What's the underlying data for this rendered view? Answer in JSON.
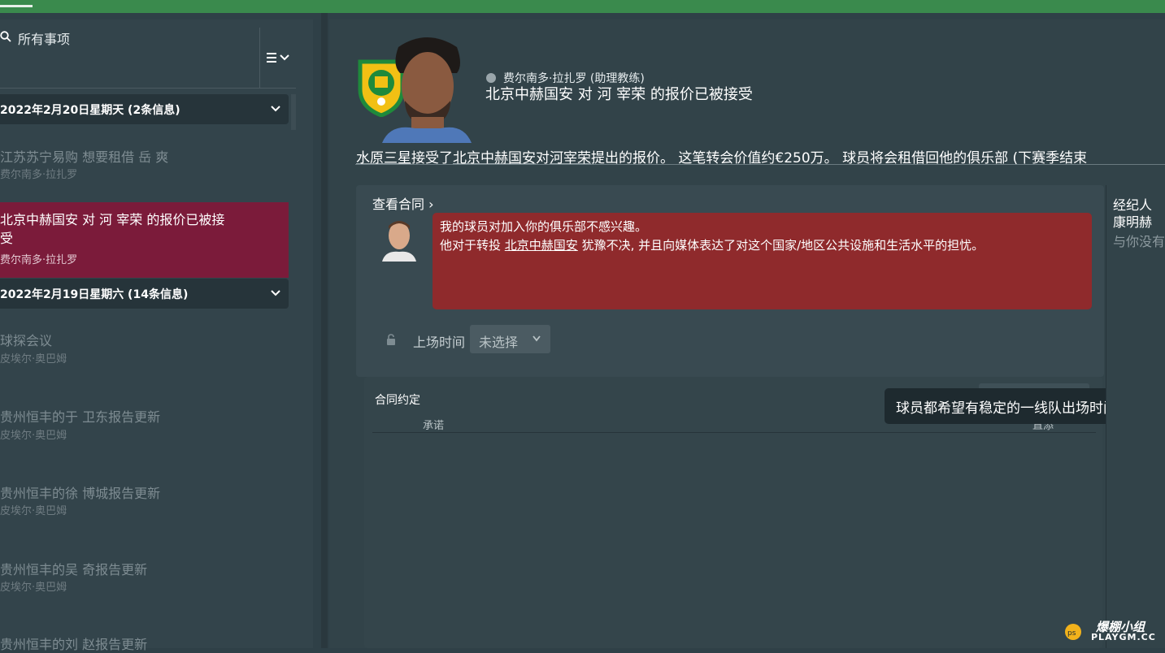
{
  "inbox": {
    "filter_label": "所有事项",
    "groups": [
      {
        "date": "2022年2月20日星期天 (2条信息)",
        "messages": [
          {
            "title": "江苏苏宁易购 想要租借 岳 爽",
            "sender": "费尔南多·拉扎罗"
          },
          {
            "title": "北京中赫国安 对 河 宰荣 的报价已被接受",
            "sender": "费尔南多·拉扎罗",
            "selected": true
          }
        ]
      },
      {
        "date": "2022年2月19日星期六 (14条信息)",
        "messages": [
          {
            "title": "球探会议",
            "sender": "皮埃尔·奥巴姆"
          },
          {
            "title": "贵州恒丰的于 卫东报告更新",
            "sender": "皮埃尔·奥巴姆"
          },
          {
            "title": "贵州恒丰的徐 博城报告更新",
            "sender": "皮埃尔·奥巴姆"
          },
          {
            "title": "贵州恒丰的吴 奇报告更新",
            "sender": "皮埃尔·奥巴姆"
          },
          {
            "title": "贵州恒丰的刘 赵报告更新",
            "sender": ""
          }
        ]
      }
    ]
  },
  "message": {
    "sender": "费尔南多·拉扎罗 (助理教练)",
    "subject": "北京中赫国安 对 河 宰荣 的报价已被接受",
    "body": {
      "p1": "水原三星",
      "p2": "接受了",
      "p3": "北京中赫国安",
      "p4": "对",
      "p5": "河宰荣",
      "p6": "提出的报价。 这笔转会价值约€250万。 球员将会租借回他的俱乐部 (下赛季结束"
    },
    "view_contract": "查看合同",
    "agent_reply": {
      "line1": "我的球员对加入你的俱乐部不感兴趣。",
      "line2_a": "他对于转投 ",
      "line2_club": "北京中赫国安",
      "line2_b": " 犹豫不决, 并且向媒体表达了对这个国家/地区公共设施和生活水平的担忧。"
    },
    "playing_time_label": "上场时间",
    "playing_time_value": "未选择",
    "contract_terms_title": "合同约定",
    "col_promise": "承诺",
    "col_status": "直添",
    "tooltip": "球员都希望有稳定的一线队出场时间."
  },
  "agent_panel": {
    "role": "经纪人",
    "name": "康明赫",
    "note": "与你没有"
  },
  "watermark": {
    "cn": "爆棚小组",
    "en": "PLAYGM.CC"
  },
  "colors": {
    "topbar": "#3a8a4d",
    "selected_item": "#7b1b3a",
    "speech_bubble": "#8f2a2c"
  }
}
